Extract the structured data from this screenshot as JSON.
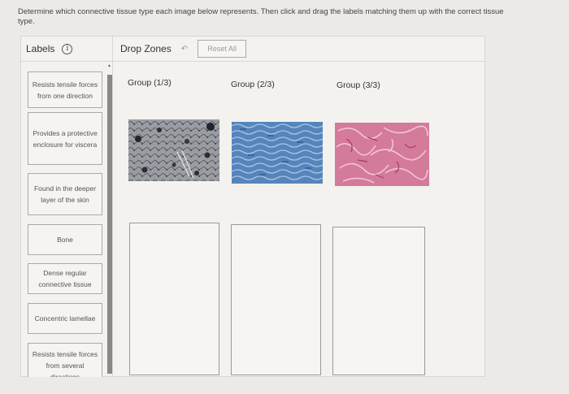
{
  "instructions": "Determine which connective tissue type each image below represents. Then click and drag the labels matching them up with the correct tissue type.",
  "labels_header": {
    "title": "Labels",
    "info_icon": "info-icon"
  },
  "dropzones_header": {
    "title": "Drop Zones",
    "undo_icon": "undo-icon",
    "reset_label": "Reset All"
  },
  "labels": [
    "Resists tensile forces from one direction",
    "Provides a protective enclosure for viscera",
    "Found in the deeper layer of the skin",
    "Bone",
    "Dense regular connective tissue",
    "Concentric lamellae",
    "Resists tensile forces from several directions"
  ],
  "groups": [
    {
      "title": "Group (1/3)",
      "image": "bone-tissue-micrograph"
    },
    {
      "title": "Group (2/3)",
      "image": "dense-regular-tissue-micrograph"
    },
    {
      "title": "Group (3/3)",
      "image": "dense-irregular-tissue-micrograph"
    }
  ],
  "colors": {
    "panel": "#f3f2ef",
    "tissue1": "#8d8f95",
    "tissue2": "#4f7fb7",
    "tissue3": "#cc6b8e"
  }
}
